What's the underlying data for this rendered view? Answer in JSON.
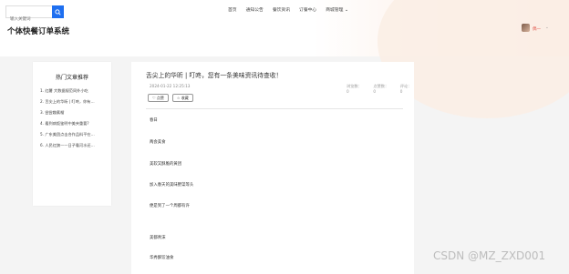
{
  "search": {
    "placeholder": "输入关键词"
  },
  "nav": {
    "items": [
      "首页",
      "通知公告",
      "餐饮资讯",
      "订餐中心",
      "商城管理"
    ],
    "dropdown_caret": "⌄"
  },
  "site": {
    "title": "个体快餐订单系统"
  },
  "user": {
    "name": "偶一",
    "caret": "⌄"
  },
  "sidebar": {
    "title": "热门文章推荐",
    "items": [
      "1. 红薯 大数据规范同外小吃",
      "2. 舌尖上的华昕 | 叮咚，你有…",
      "3. 尝尝趣素榴",
      "4. 看到病饭鉴明中美夹重要?",
      "5. 广东美团点击合作品料平在…",
      "6. 人民红旗——日子看河水还…"
    ]
  },
  "article": {
    "title": "舌尖上的华昕 | 叮咚，您有一条美味资讯待查收！",
    "date": "2024-01-22 12:25:13",
    "views_label": "浏览数：",
    "views_value": "0",
    "likes_label": "点赞数：",
    "likes_value": "0",
    "comments_label": "评论：",
    "comments_value": "0",
    "like_button": "♡ 点赞",
    "collect_button": "☆ 收藏",
    "paragraphs": [
      "春日",
      "两会美食",
      "美软又酥脆的黄团",
      "加入春天的美味野菜等头",
      "便是到了一个周都有许",
      "美都青沫",
      "华秀酥饺油食"
    ]
  },
  "watermark": "CSDN @MZ_ZXD001"
}
